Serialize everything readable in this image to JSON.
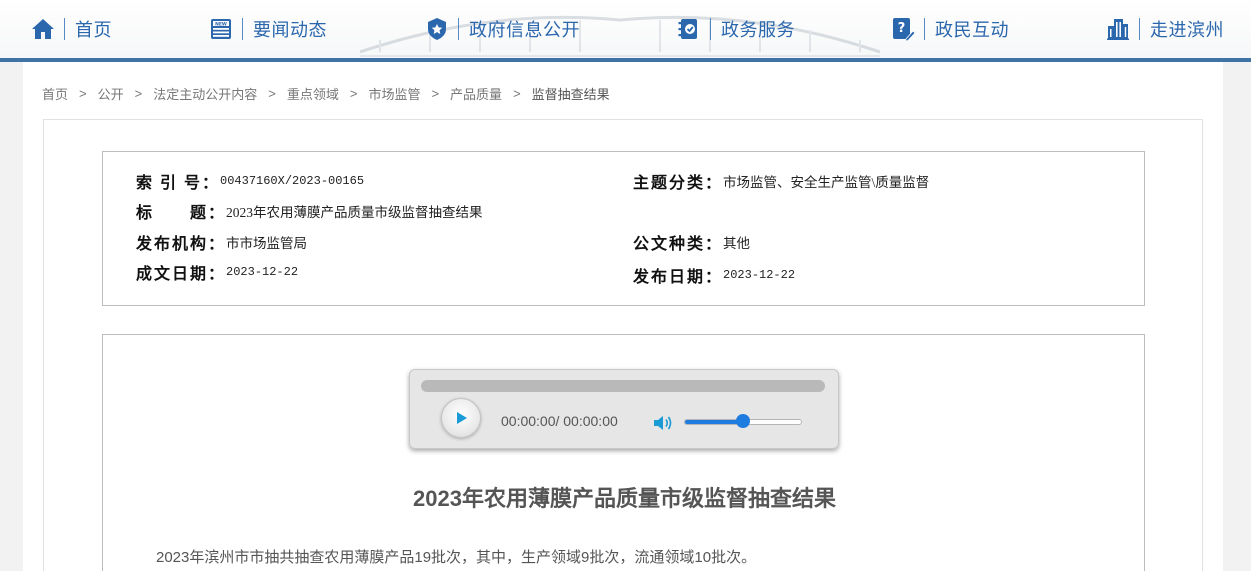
{
  "nav": {
    "items": [
      {
        "label": "首页",
        "icon": "home-icon"
      },
      {
        "label": "要闻动态",
        "icon": "news-icon"
      },
      {
        "label": "政府信息公开",
        "icon": "badge-icon"
      },
      {
        "label": "政务服务",
        "icon": "service-icon"
      },
      {
        "label": "政民互动",
        "icon": "question-edit-icon"
      },
      {
        "label": "走进滨州",
        "icon": "building-icon"
      }
    ],
    "accent_color": "#2b67ad",
    "bar_color": "#3f73a6"
  },
  "breadcrumb": {
    "items": [
      "首页",
      "公开",
      "法定主动公开内容",
      "重点领域",
      "市场监管",
      "产品质量"
    ],
    "separator": ">",
    "current": "监督抽查结果"
  },
  "meta": {
    "index_label": "索 引 号：",
    "index_value": "00437160X/2023-00165",
    "topic_label": "主题分类：",
    "topic_value": "市场监管、安全生产监管\\质量监督",
    "title_label": "标　　题：",
    "title_value": "2023年农用薄膜产品质量市级监督抽查结果",
    "publisher_label": "发布机构：",
    "publisher_value": "市市场监管局",
    "doctype_label": "公文种类：",
    "doctype_value": "其他",
    "written_label": "成文日期：",
    "written_value": "2023-12-22",
    "published_label": "发布日期：",
    "published_value": "2023-12-22"
  },
  "player": {
    "time_text": "00:00:00/ 00:00:00",
    "progress_fraction": 0,
    "volume_fraction": 0.5,
    "accent_color": "#1e7be0"
  },
  "article": {
    "title": "2023年农用薄膜产品质量市级监督抽查结果",
    "paragraph": "2023年滨州市市抽共抽查农用薄膜产品19批次，其中，生产领域9批次，流通领域10批次。"
  }
}
